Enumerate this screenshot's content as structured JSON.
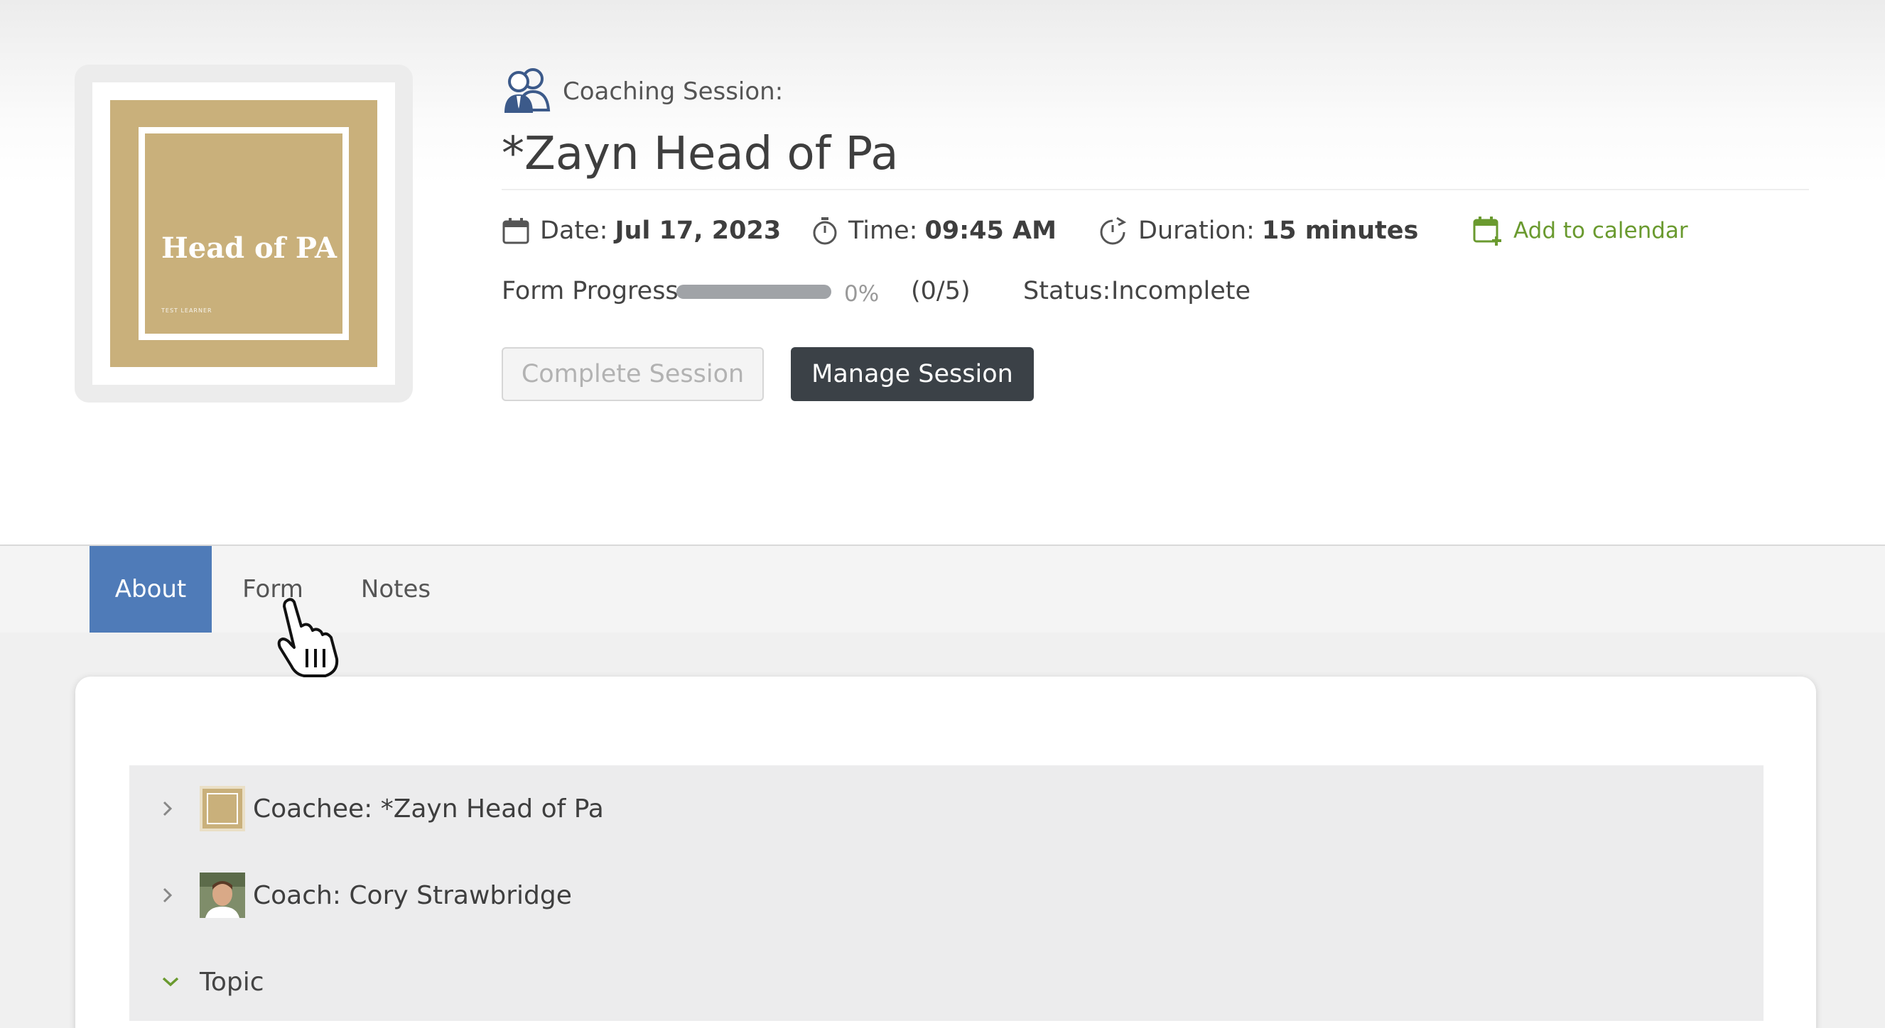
{
  "thumbnail": {
    "title": "Head of PA",
    "subtitle": "TEST LEARNER"
  },
  "session": {
    "type_label": "Coaching Session:",
    "title": "*Zayn Head of Pa",
    "date_label": "Date:",
    "date_value": "Jul 17, 2023",
    "time_label": "Time:",
    "time_value": "09:45 AM",
    "duration_label": "Duration:",
    "duration_value": "15 minutes",
    "add_calendar_label": "Add to calendar"
  },
  "progress": {
    "label": "Form Progress",
    "percent": 0,
    "percent_text": "0%",
    "count_text": "(0/5)",
    "status_label": "Status:",
    "status_value": "Incomplete"
  },
  "buttons": {
    "complete": "Complete Session",
    "manage": "Manage Session"
  },
  "tabs": [
    {
      "label": "About",
      "active": true
    },
    {
      "label": "Form",
      "active": false
    },
    {
      "label": "Notes",
      "active": false
    }
  ],
  "accordion": {
    "coachee": "Coachee: *Zayn Head of Pa",
    "coach": "Coach: Cory Strawbridge",
    "topic": "Topic"
  },
  "colors": {
    "accent_blue": "#4f7bb8",
    "dark_button": "#3b4147",
    "calendar_green": "#6a9a2f",
    "thumb_gold": "#c9b07b"
  },
  "icons": {
    "session": "people-icon",
    "date": "calendar-icon",
    "time": "stopwatch-icon",
    "duration": "timer-icon",
    "add_calendar": "calendar-plus-icon",
    "collapsed": "chevron-right-icon",
    "expanded": "chevron-down-icon",
    "cursor": "hand-pointer-icon"
  }
}
